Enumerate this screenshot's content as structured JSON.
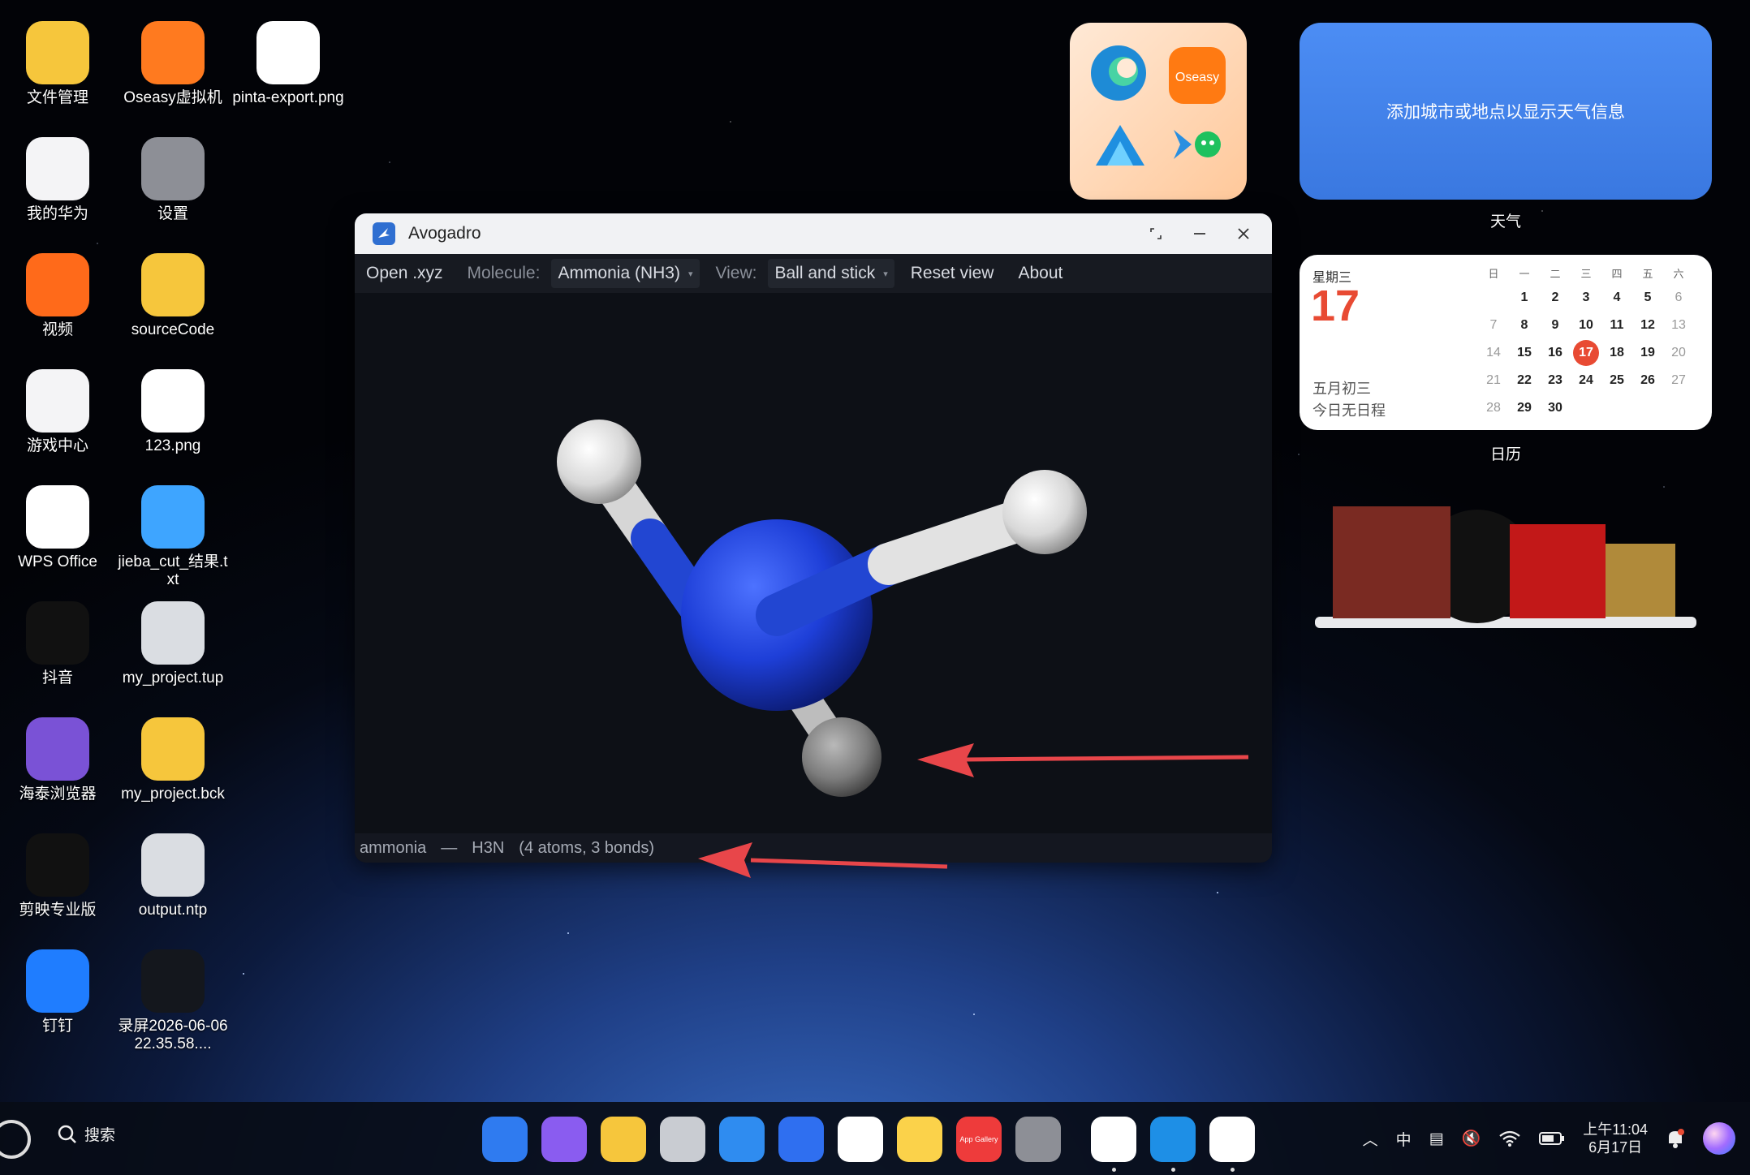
{
  "desktop_icons": [
    {
      "label": "文件管理",
      "icon": "folder-icon",
      "color": "#f6c63c"
    },
    {
      "label": "Oseasy虚拟机",
      "icon": "oseasy-vm-icon",
      "color": "#ff7a1f"
    },
    {
      "label": "pinta-export.png",
      "icon": "image-file-icon",
      "color": "#ffffff"
    },
    {
      "label": "我的华为",
      "icon": "myhuawei-icon",
      "color": "#f4f4f6"
    },
    {
      "label": "设置",
      "icon": "settings-icon",
      "color": "#8d8f96"
    },
    {
      "label": "视频",
      "icon": "video-icon",
      "color": "#ff6a1a"
    },
    {
      "label": "sourceCode",
      "icon": "folder-icon",
      "color": "#f6c63c"
    },
    {
      "label": "游戏中心",
      "icon": "game-center-icon",
      "color": "#f4f4f6"
    },
    {
      "label": "123.png",
      "icon": "image-file-icon",
      "color": "#ffffff"
    },
    {
      "label": "WPS Office",
      "icon": "wps-icon",
      "color": "#ffffff"
    },
    {
      "label": "jieba_cut_结果.txt",
      "icon": "txt-file-icon",
      "color": "#3ea5ff"
    },
    {
      "label": "抖音",
      "icon": "douyin-icon",
      "color": "#111111"
    },
    {
      "label": "my_project.tup",
      "icon": "unknown-file-icon",
      "color": "#dadde2"
    },
    {
      "label": "海泰浏览器",
      "icon": "browser-icon",
      "color": "#7a52d6"
    },
    {
      "label": "my_project.bck",
      "icon": "folder-icon",
      "color": "#f6c63c"
    },
    {
      "label": "剪映专业版",
      "icon": "capcut-icon",
      "color": "#111111"
    },
    {
      "label": "output.ntp",
      "icon": "unknown-file-icon",
      "color": "#dadde2"
    },
    {
      "label": "钉钉",
      "icon": "dingtalk-icon",
      "color": "#1f7dff"
    },
    {
      "label": "录屏2026-06-06 22.35.58....",
      "icon": "screen-recording-thumb-icon",
      "color": "#14171d"
    }
  ],
  "widgets": {
    "folder_apps": [
      "edge-icon",
      "oseasy-icon",
      "app-icon",
      "vscode-icon",
      "wechat-icon"
    ],
    "oseasy_label": "Oseasy",
    "weather": {
      "text": "添加城市或地点以显示天气信息",
      "caption": "天气"
    },
    "calendar": {
      "weekday": "星期三",
      "day": "17",
      "lunar": "五月初三",
      "schedule": "今日无日程",
      "caption": "日历",
      "headers": [
        "日",
        "一",
        "二",
        "三",
        "四",
        "五",
        "六"
      ],
      "weeks": [
        [
          "",
          "1",
          "2",
          "3",
          "4",
          "5",
          "6"
        ],
        [
          "7",
          "8",
          "9",
          "10",
          "11",
          "12",
          "13"
        ],
        [
          "14",
          "15",
          "16",
          "17",
          "18",
          "19",
          "20"
        ],
        [
          "21",
          "22",
          "23",
          "24",
          "25",
          "26",
          "27"
        ],
        [
          "28",
          "29",
          "30",
          "",
          "",
          "",
          ""
        ]
      ],
      "today": "17"
    }
  },
  "window": {
    "title": "Avogadro",
    "menu": {
      "open": "Open .xyz",
      "molecule_label": "Molecule:",
      "molecule_value": "Ammonia (NH3)",
      "view_label": "View:",
      "view_value": "Ball and stick",
      "reset": "Reset view",
      "about": "About"
    },
    "status": {
      "name": "ammonia",
      "sep": "—",
      "formula": "H3N",
      "counts": "(4 atoms, 3 bonds)"
    },
    "colors": {
      "nitrogen": "#1e3fd8",
      "hydrogen": "#e6e6e6",
      "background": "#0d1016"
    }
  },
  "taskbar": {
    "search": "搜索",
    "dock": [
      "app-grid-icon",
      "multitask-icon",
      "notes-icon",
      "trash-icon",
      "browser-icon",
      "mail-icon",
      "gallery-icon",
      "memo-icon",
      "appgallery-icon",
      "settings-icon",
      "wps-icon",
      "images-icon",
      "avogadro-icon"
    ],
    "appgallery_label": "App Gallery",
    "ime": "中",
    "time": "上午11:04",
    "date": "6月17日"
  }
}
